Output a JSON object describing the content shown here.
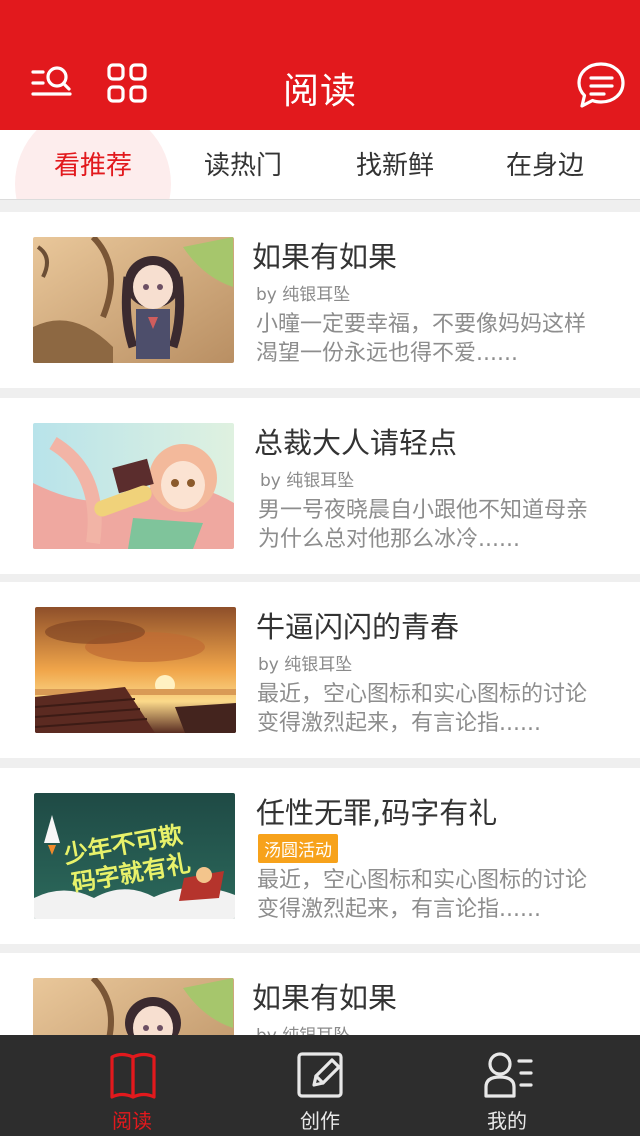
{
  "header": {
    "title": "阅读",
    "left_icons": [
      "search-menu-icon",
      "grid-icon"
    ],
    "right_icon": "message-icon",
    "color": "#e2191d"
  },
  "tabs": [
    {
      "label": "看推荐",
      "active": true
    },
    {
      "label": "读热门",
      "active": false
    },
    {
      "label": "找新鲜",
      "active": false
    },
    {
      "label": "在身边",
      "active": false
    }
  ],
  "articles": [
    {
      "title": "如果有如果",
      "author": "by 纯银耳坠",
      "desc": "小曈一定要幸福，不要像妈妈这样渴望一份永远也得不爱......",
      "image": "anime-girl-with-braids"
    },
    {
      "title": "总裁大人请轻点",
      "author": "by 纯银耳坠",
      "desc": "男一号夜晓晨自小跟他不知道母亲为什么总对他那么冰冷......",
      "image": "anime-girl-with-book"
    },
    {
      "title": "牛逼闪闪的青春",
      "author": "by 纯银耳坠",
      "desc": "最近，空心图标和实心图标的讨论变得激烈起来，有言论指......",
      "image": "sunset-rooftops"
    },
    {
      "title": "任性无罪,码字有礼",
      "badge": "汤圆活动",
      "desc": "最近，空心图标和实心图标的讨论变得激烈起来，有言论指......",
      "image": "event-banner",
      "banner_text": [
        "少年不可欺",
        "码字就有礼"
      ]
    },
    {
      "title": "如果有如果",
      "author": "by 纯银耳坠",
      "desc": "",
      "image": "anime-girl-with-braids"
    }
  ],
  "bottom_nav": [
    {
      "label": "阅读",
      "icon": "book-icon",
      "active": true
    },
    {
      "label": "创作",
      "icon": "edit-icon",
      "active": false
    },
    {
      "label": "我的",
      "icon": "profile-icon",
      "active": false
    }
  ]
}
